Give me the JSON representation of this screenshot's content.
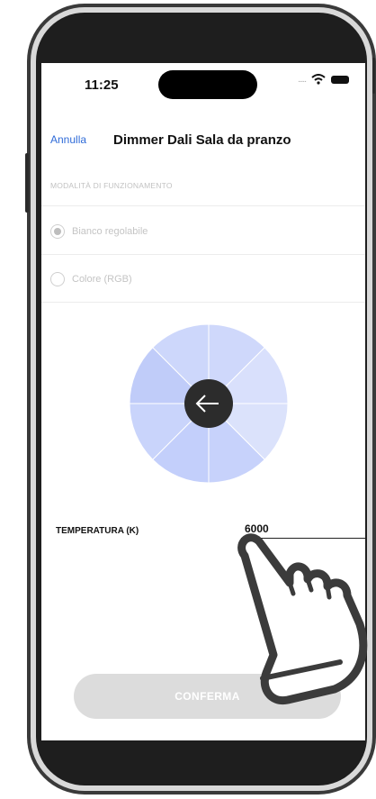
{
  "status_bar": {
    "time": "11:25",
    "icons": [
      "signal-dots-icon",
      "wifi-icon",
      "battery-icon"
    ]
  },
  "header": {
    "cancel_label": "Annulla",
    "title": "Dimmer Dali Sala da pranzo"
  },
  "mode_section": {
    "title": "MODALITÀ DI FUNZIONAMENTO",
    "options": [
      {
        "label": "Bianco regolabile",
        "selected": true
      },
      {
        "label": "Colore (RGB)",
        "selected": false
      }
    ]
  },
  "color_wheel": {
    "center_icon": "arrow-left-icon",
    "segment_colors": [
      "#cfd8fb",
      "#d9e0fc",
      "#dbe2fb",
      "#c7d2fb",
      "#c3cffb",
      "#c9d4fb",
      "#c0ccf9",
      "#cdd7fb"
    ]
  },
  "temperature": {
    "label": "TEMPERATURA (K)",
    "value": "6000"
  },
  "confirm_button": {
    "label": "CONFERMA"
  },
  "colors": {
    "accent_link": "#2f6bd8",
    "disabled_button": "#dcdcdc"
  },
  "overlay": {
    "icon": "pointing-hand-icon"
  }
}
